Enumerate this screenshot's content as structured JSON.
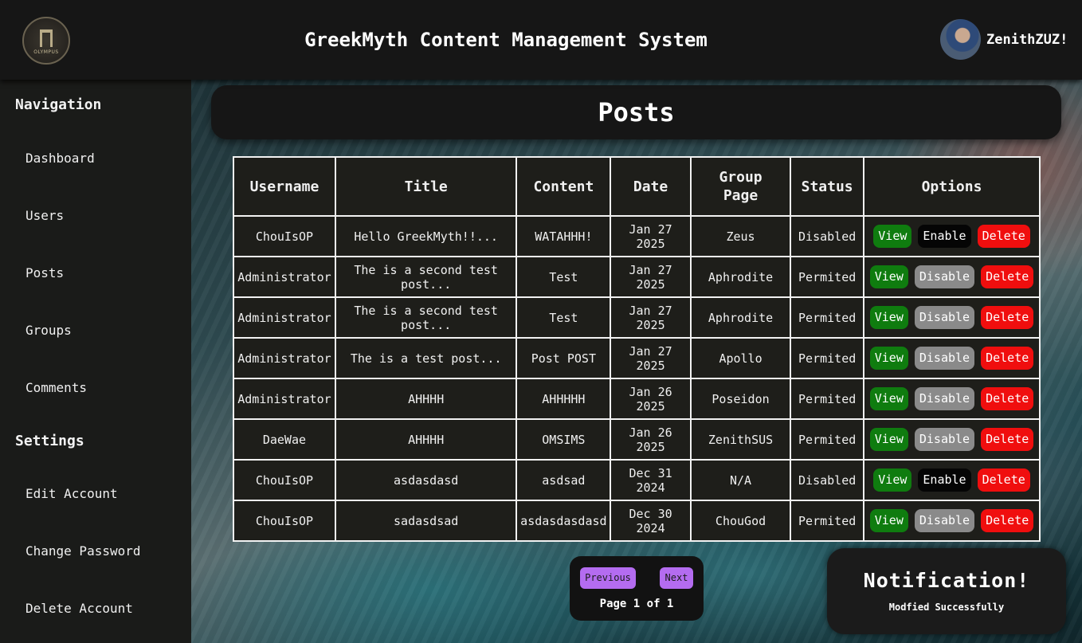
{
  "header": {
    "logo_text": "OLYMPUS",
    "title": "GreekMyth Content Management System",
    "username": "ZenithZUZ!"
  },
  "sidebar": {
    "nav_heading": "Navigation",
    "nav_items": [
      "Dashboard",
      "Users",
      "Posts",
      "Groups",
      "Comments"
    ],
    "settings_heading": "Settings",
    "settings_items": [
      "Edit Account",
      "Change Password",
      "Delete Account"
    ]
  },
  "main": {
    "page_title": "Posts",
    "table": {
      "columns": [
        "Username",
        "Title",
        "Content",
        "Date",
        "Group Page",
        "Status",
        "Options"
      ],
      "rows": [
        {
          "username": "ChouIsOP",
          "title": "Hello GreekMyth!!...",
          "content": "WATAHHH!",
          "date": "Jan 27 2025",
          "group": "Zeus",
          "status": "Disabled",
          "view": "View",
          "toggle": "Enable",
          "delete": "Delete"
        },
        {
          "username": "Administrator",
          "title": "The is a second test post...",
          "content": "Test",
          "date": "Jan 27 2025",
          "group": "Aphrodite",
          "status": "Permited",
          "view": "View",
          "toggle": "Disable",
          "delete": "Delete"
        },
        {
          "username": "Administrator",
          "title": "The is a second test post...",
          "content": "Test",
          "date": "Jan 27 2025",
          "group": "Aphrodite",
          "status": "Permited",
          "view": "View",
          "toggle": "Disable",
          "delete": "Delete"
        },
        {
          "username": "Administrator",
          "title": "The is a test post...",
          "content": "Post POST",
          "date": "Jan 27 2025",
          "group": "Apollo",
          "status": "Permited",
          "view": "View",
          "toggle": "Disable",
          "delete": "Delete"
        },
        {
          "username": "Administrator",
          "title": "AHHHH",
          "content": "AHHHHH",
          "date": "Jan 26 2025",
          "group": "Poseidon",
          "status": "Permited",
          "view": "View",
          "toggle": "Disable",
          "delete": "Delete"
        },
        {
          "username": "DaeWae",
          "title": "AHHHH",
          "content": "OMSIMS",
          "date": "Jan 26 2025",
          "group": "ZenithSUS",
          "status": "Permited",
          "view": "View",
          "toggle": "Disable",
          "delete": "Delete"
        },
        {
          "username": "ChouIsOP",
          "title": "asdasdasd",
          "content": "asdsad",
          "date": "Dec 31 2024",
          "group": "N/A",
          "status": "Disabled",
          "view": "View",
          "toggle": "Enable",
          "delete": "Delete"
        },
        {
          "username": "ChouIsOP",
          "title": "sadasdsad",
          "content": "asdasdasdasd",
          "date": "Dec 30 2024",
          "group": "ChouGod",
          "status": "Permited",
          "view": "View",
          "toggle": "Disable",
          "delete": "Delete"
        }
      ]
    },
    "pagination": {
      "previous_label": "Previous",
      "next_label": "Next",
      "page_info": "Page 1 of 1"
    }
  },
  "notification": {
    "title": "Notification!",
    "message": "Modfied Successfully"
  },
  "colors": {
    "view": "#0f7c0f",
    "disable": "#8a8a8a",
    "enable": "#050505",
    "delete": "#f00e0e",
    "pager_button": "#b46cf0"
  }
}
